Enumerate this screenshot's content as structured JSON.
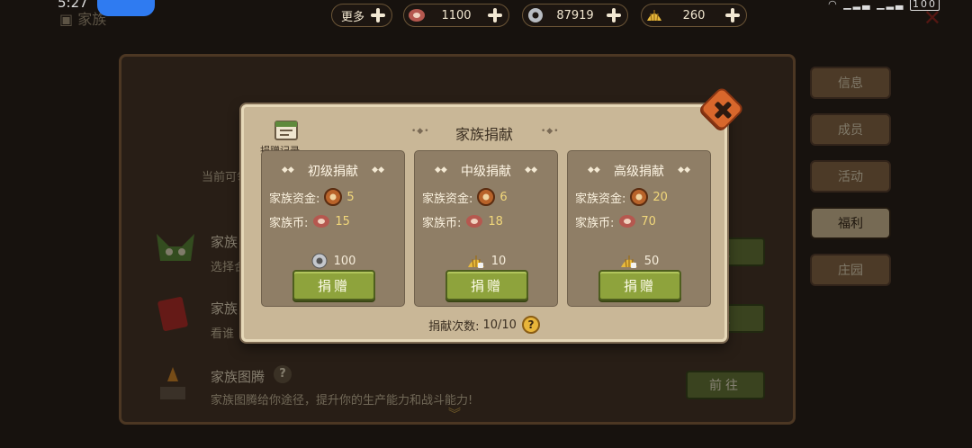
{
  "status": {
    "time": "5:27",
    "battery": "100"
  },
  "header": {
    "title": "家族",
    "more_label": "更多",
    "resources": [
      {
        "icon": "meat-icon",
        "value": "1100"
      },
      {
        "icon": "gear-icon",
        "value": "87919"
      },
      {
        "icon": "shell-icon",
        "value": "260"
      }
    ]
  },
  "background": {
    "current_label": "当前可领",
    "rows": [
      {
        "title": "家族",
        "desc": "选择合"
      },
      {
        "title": "家族",
        "desc": "看谁"
      },
      {
        "title": "家族图腾",
        "desc": "家族图腾给你途径，提升你的生产能力和战斗能力!"
      }
    ],
    "goto_labels": [
      "往",
      "往",
      "前往"
    ],
    "side_tabs": [
      "信息",
      "成员",
      "活动",
      "福利",
      "庄园"
    ]
  },
  "dialog": {
    "title": "家族捐献",
    "record_label": "捐赠记录",
    "fund_label": "家族资金:",
    "coin_label": "家族币:",
    "donate_label": "捐赠",
    "tiers": [
      {
        "title": "初级捐献",
        "fund": "5",
        "coin": "15",
        "cost": "100",
        "cost_icon": "gear-icon"
      },
      {
        "title": "中级捐献",
        "fund": "6",
        "coin": "18",
        "cost": "10",
        "cost_icon": "shell-icon"
      },
      {
        "title": "高级捐献",
        "fund": "20",
        "coin": "70",
        "cost": "50",
        "cost_icon": "shell-icon"
      }
    ],
    "count_label": "捐献次数:",
    "count_value": "10/10",
    "help": "?"
  },
  "colors": {
    "dialog_bg": "#c9b797",
    "card_bg": "#8f7e66",
    "button_green": "#8ea33c",
    "close_orange": "#d8672c"
  }
}
